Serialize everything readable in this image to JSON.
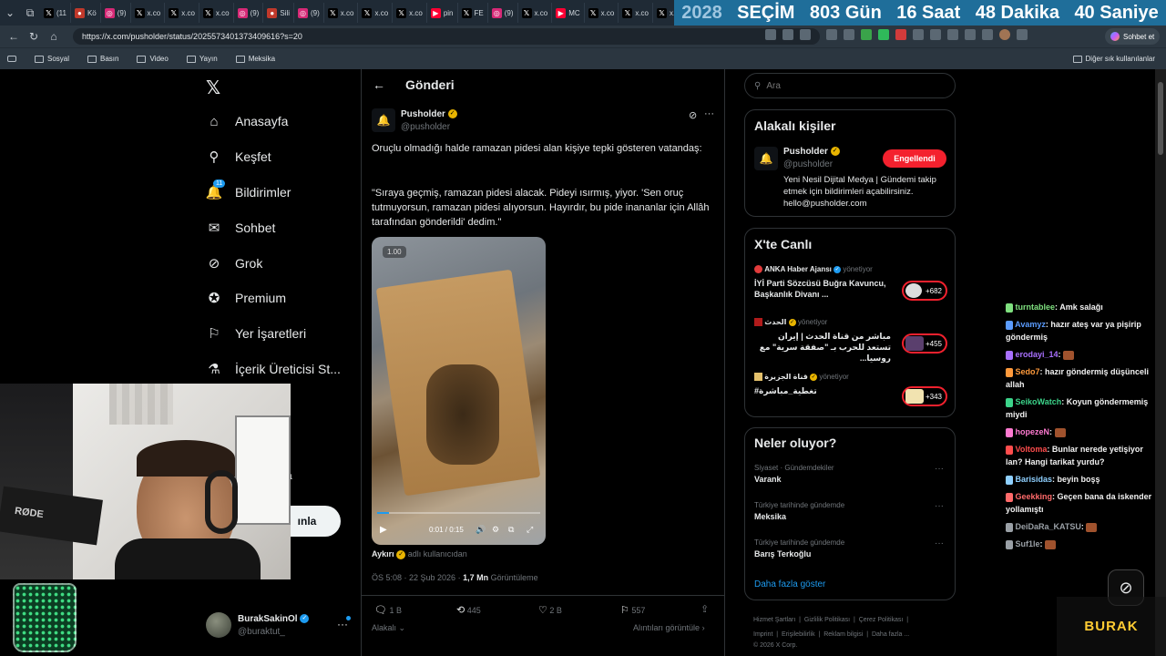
{
  "browser": {
    "tabs": [
      {
        "label": "(11",
        "icon": "x-icon"
      },
      {
        "label": "Kö",
        "icon": "site-icon"
      },
      {
        "label": "(9)",
        "icon": "instagram-icon"
      },
      {
        "label": "x.co",
        "icon": "x-icon"
      },
      {
        "label": "x.co",
        "icon": "x-icon"
      },
      {
        "label": "x.co",
        "icon": "x-icon"
      },
      {
        "label": "(9)",
        "icon": "instagram-icon"
      },
      {
        "label": "Sili",
        "icon": "site-icon"
      },
      {
        "label": "(9)",
        "icon": "instagram-icon"
      },
      {
        "label": "x.co",
        "icon": "x-icon"
      },
      {
        "label": "x.co",
        "icon": "x-icon"
      },
      {
        "label": "x.co",
        "icon": "x-icon"
      },
      {
        "label": "pin",
        "icon": "youtube-icon"
      },
      {
        "label": "FE",
        "icon": "x-icon"
      },
      {
        "label": "(9)",
        "icon": "instagram-icon"
      },
      {
        "label": "x.co",
        "icon": "x-icon"
      },
      {
        "label": "MC",
        "icon": "youtube-icon"
      },
      {
        "label": "x.co",
        "icon": "x-icon"
      },
      {
        "label": "x.co",
        "icon": "x-icon"
      },
      {
        "label": "x.co",
        "icon": "x-icon"
      },
      {
        "label": "x.co",
        "icon": "x-icon"
      }
    ],
    "countdown": {
      "year": "2028",
      "label": "SEÇİM",
      "days": "803 Gün",
      "hours": "16 Saat",
      "minutes": "48 Dakika",
      "seconds": "40 Saniye"
    },
    "url": "https://x.com/pusholder/status/2025573401373409616?s=20",
    "chat_button": "Sohbet et",
    "bookmarks": [
      "Sosyal",
      "Basın",
      "Video",
      "Yayın",
      "Meksika"
    ],
    "other_bookmarks": "Diğer sık kullanılanlar"
  },
  "sidebar": {
    "items": [
      {
        "label": "Anasayfa",
        "icon": "home-icon"
      },
      {
        "label": "Keşfet",
        "icon": "search-icon"
      },
      {
        "label": "Bildirimler",
        "icon": "bell-icon",
        "badge": "11"
      },
      {
        "label": "Sohbet",
        "icon": "mail-icon"
      },
      {
        "label": "Grok",
        "icon": "grok-icon"
      },
      {
        "label": "Premium",
        "icon": "premium-icon"
      },
      {
        "label": "Yer İşaretleri",
        "icon": "bookmark-icon"
      },
      {
        "label": "İçerik Üreticisi St...",
        "icon": "flask-icon"
      }
    ],
    "post_button_partial": "ınla",
    "more_partial": "a",
    "account": {
      "name": "BurakSakinOl",
      "handle": "@buraktut_"
    }
  },
  "post": {
    "header": "Gönderi",
    "author": {
      "name": "Pusholder",
      "handle": "@pusholder"
    },
    "text1": "Oruçlu olmadığı halde ramazan pidesi alan kişiye tepki gösteren vatandaş:",
    "text2": "\"Sıraya geçmiş, ramazan pidesi alacak. Pideyi ısırmış, yiyor. 'Sen oruç tutmuyorsun, ramazan pidesi alıyorsun. Hayırdır, bu pide inananlar için Allâh tarafından gönderildi' dedim.\"",
    "video": {
      "speed": "1.00",
      "time": "0:01 / 0:15",
      "progress": 0.07
    },
    "source": {
      "name": "Aykırı",
      "suffix": "adlı kullanıcıdan"
    },
    "meta": {
      "time": "ÖS 5:08 · 22 Şub 2026 · ",
      "views": "1,7 Mn",
      "views_label": " Görüntüleme"
    },
    "actions": {
      "replies": "1 B",
      "reposts": "445",
      "likes": "2 B",
      "bookmarks": "557"
    },
    "footer_left": "Alakalı",
    "footer_right": "Alıntıları görüntüle"
  },
  "right": {
    "search_placeholder": "Ara",
    "related": {
      "title": "Alakalı kişiler",
      "name": "Pusholder",
      "handle": "@pusholder",
      "button": "Engellendi",
      "bio": "Yeni Nesil Dijital Medya | Gündemi takip etmek için bildirimleri açabilirsiniz. hello@pusholder.com"
    },
    "live": {
      "title": "X'te Canlı",
      "items": [
        {
          "host": "ANKA Haber Ajansı",
          "role": "yönetiyor",
          "title": "İYİ Parti Sözcüsü Buğra Kavuncu, Başkanlık Divanı ...",
          "count": "+682"
        },
        {
          "host": "الحدث",
          "role": "yönetiyor",
          "title": "مباشر من قناة الحدث | إيران تستعد للحرب بـ \"صفقة سرية\" مع روسيا...",
          "count": "+455"
        },
        {
          "host": "قناة الجزيرة",
          "role": "yönetiyor",
          "title": "#تغطية_مباشرة",
          "count": "+343"
        }
      ]
    },
    "trends": {
      "title": "Neler oluyor?",
      "items": [
        {
          "category": "Siyaset · Gündemdekiler",
          "name": "Varank"
        },
        {
          "category": "Türkiye tarihinde gündemde",
          "name": "Meksika"
        },
        {
          "category": "Türkiye tarihinde gündemde",
          "name": "Barış Terkoğlu"
        }
      ],
      "show_more": "Daha fazla göster"
    },
    "footer": {
      "links1": [
        "Hizmet Şartları",
        "Gizlilik Politikası",
        "Çerez Politikası"
      ],
      "links2": [
        "Imprint",
        "Erişilebilirlik",
        "Reklam bilgisi",
        "Daha fazla ..."
      ],
      "copyright": "© 2026 X Corp."
    }
  },
  "stream": {
    "mic_label": "RØDE",
    "logo": "BURAK",
    "chat": [
      {
        "user": "turntablee",
        "text": "Amk salağı",
        "color": "#7fe07f"
      },
      {
        "user": "Avamyz",
        "text": "hazır ateş var ya pişirip göndermiş",
        "color": "#5b9cff"
      },
      {
        "user": "erodayi_14",
        "text": "",
        "color": "#a970ff"
      },
      {
        "user": "Sedo7",
        "text": "hazır göndermiş düşünceli allah",
        "color": "#ff9a3c"
      },
      {
        "user": "SeikoWatch",
        "text": "Koyun göndermemiş miydi",
        "color": "#3cd48a"
      },
      {
        "user": "hopezeN",
        "text": "",
        "color": "#ff7ad1"
      },
      {
        "user": "Voltoma",
        "text": "Bunlar nerede yetişiyor lan? Hangi tarikat yurdu?",
        "color": "#ff4d4d"
      },
      {
        "user": "Barisidas",
        "text": "beyin boşş",
        "color": "#8fd0ff"
      },
      {
        "user": "Geekking",
        "text": "Geçen bana da iskender yollamıştı",
        "color": "#ff6a6a"
      },
      {
        "user": "DeiDaRa_KATSU",
        "text": "",
        "color": "#9aa0a6"
      },
      {
        "user": "Suf1le",
        "text": "",
        "color": "#9aa0a6"
      }
    ]
  }
}
